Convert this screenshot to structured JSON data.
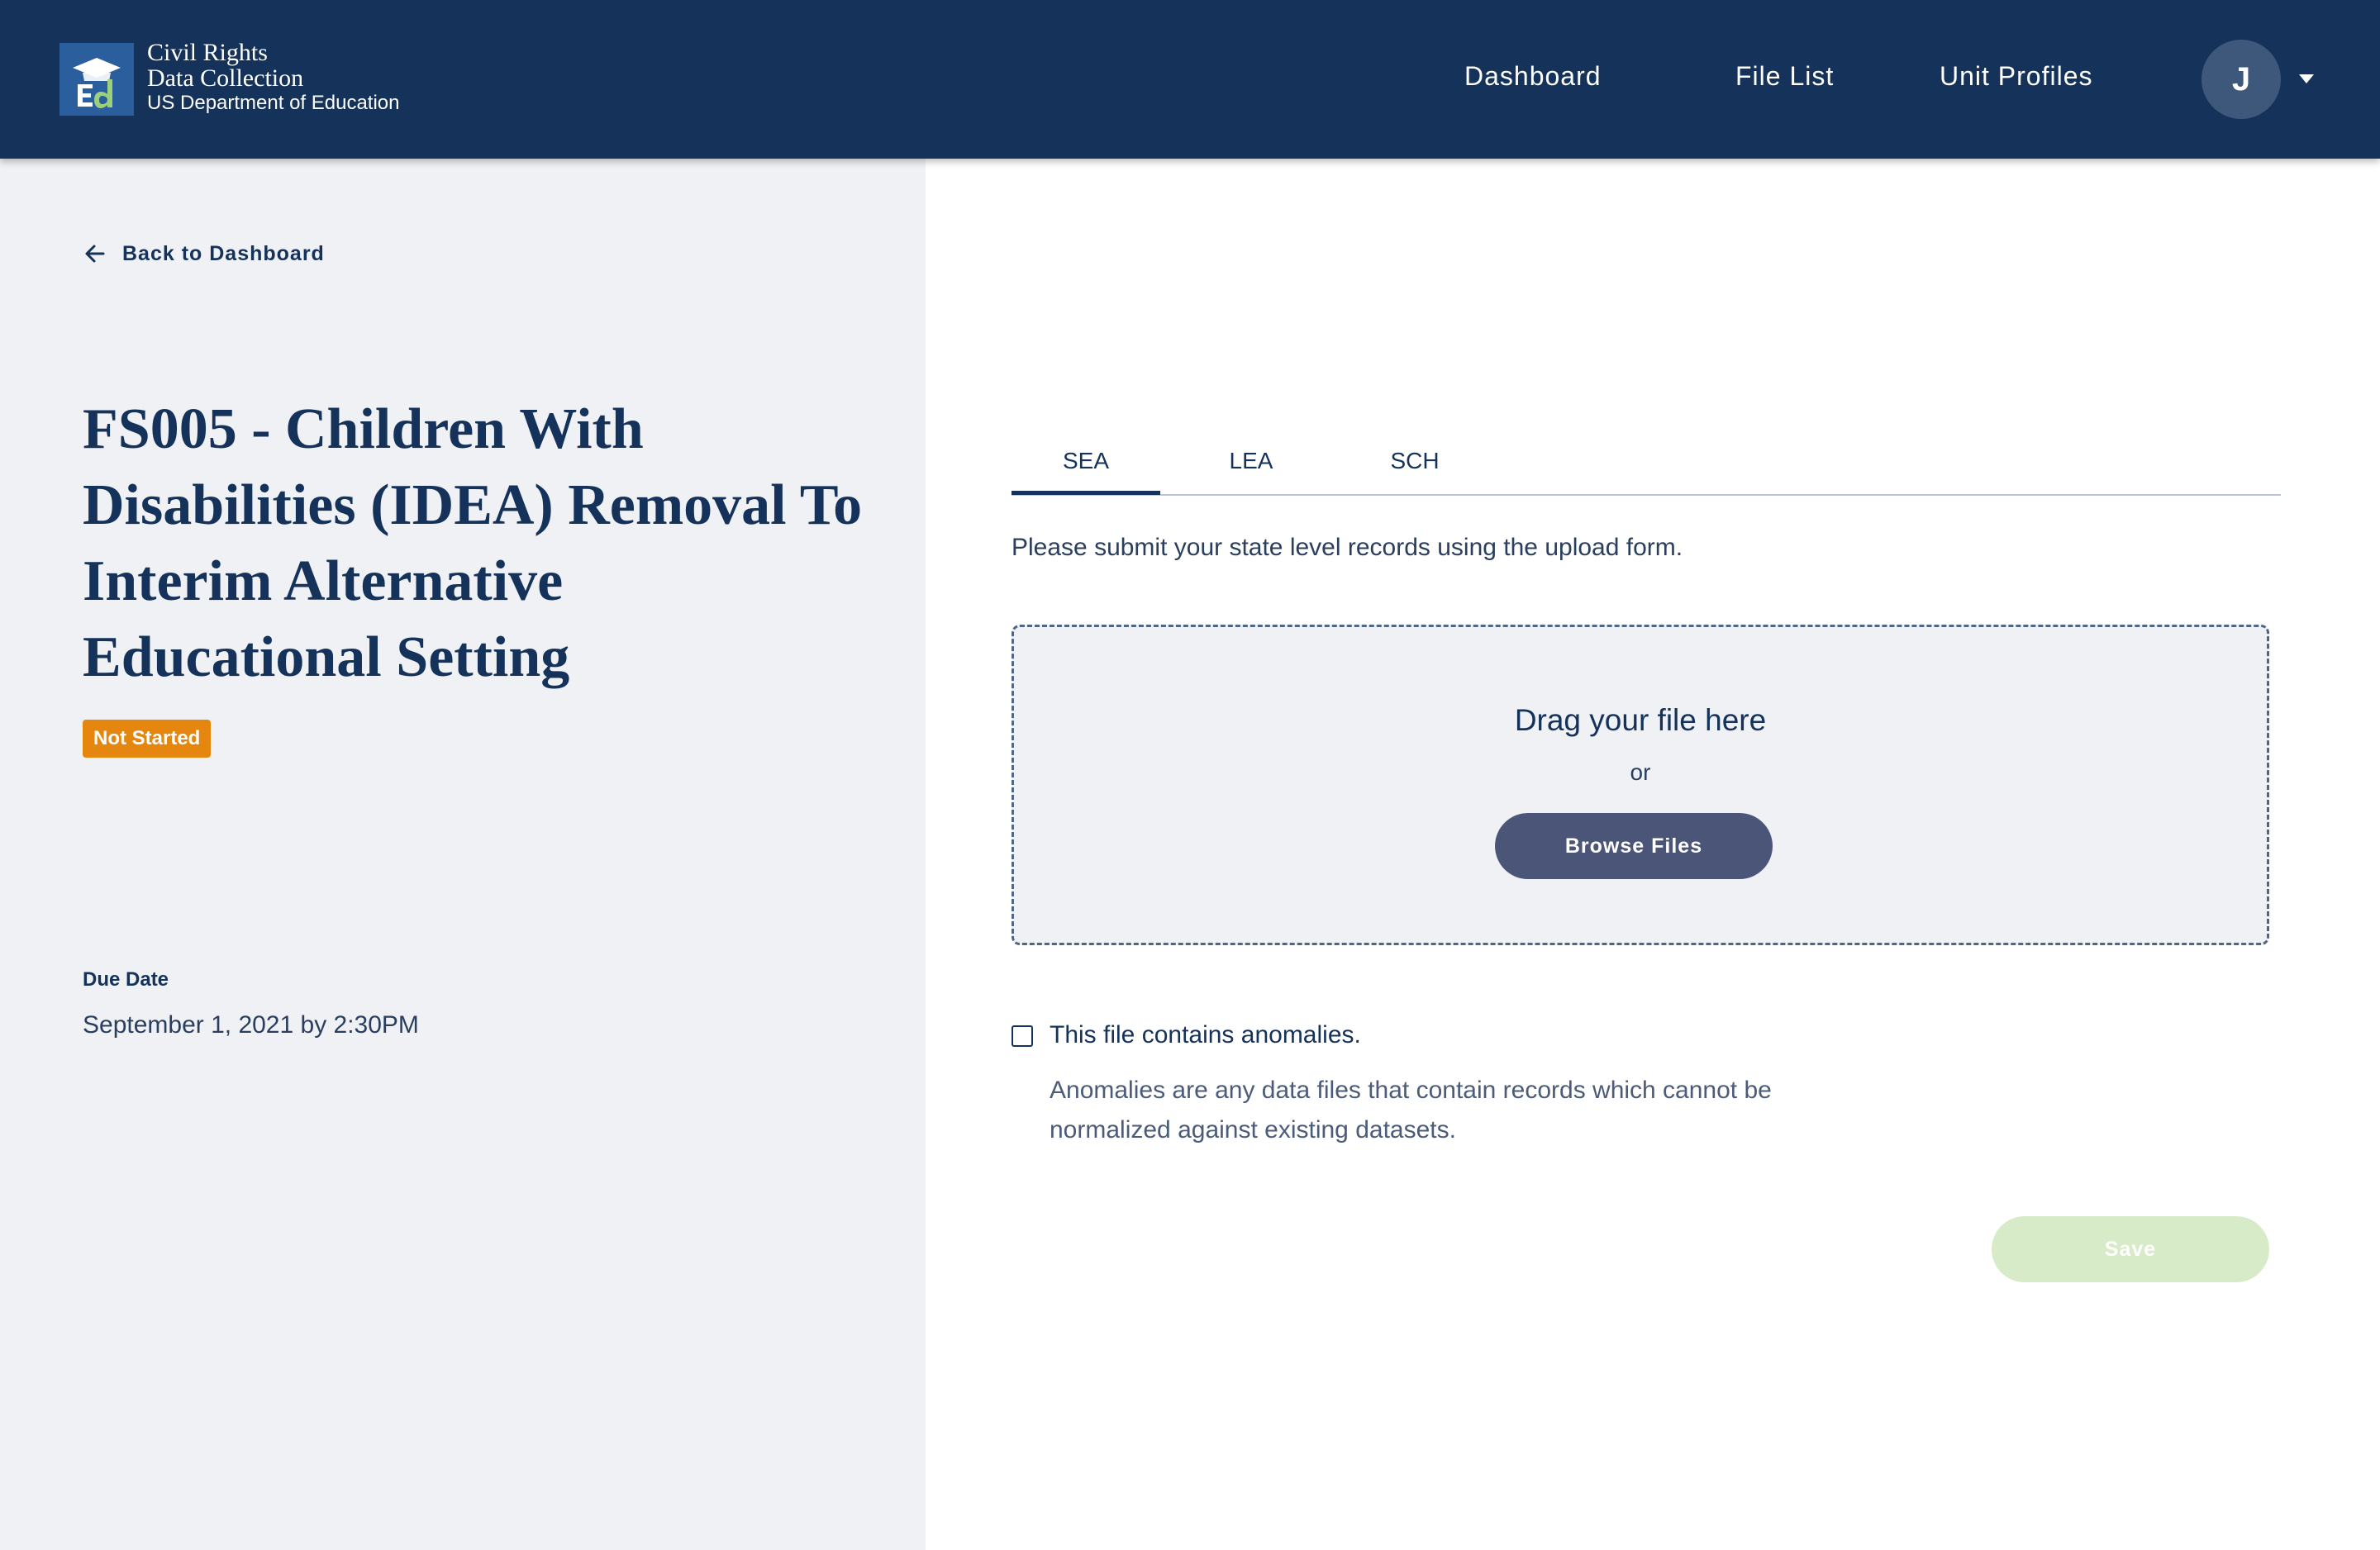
{
  "header": {
    "brand": {
      "line1": "Civil Rights",
      "line2": "Data Collection",
      "line3": "US Department of Education",
      "logo_text": "Ed",
      "logo_icon": "graduation-cap-icon"
    },
    "nav": {
      "dashboard": "Dashboard",
      "file_list": "File List",
      "unit_profiles": "Unit Profiles"
    },
    "user": {
      "initial": "J",
      "menu_icon": "caret-down-icon"
    }
  },
  "left_panel": {
    "back_link": {
      "label": "Back to Dashboard",
      "icon": "arrow-left-icon"
    },
    "title": "FS005 - Children With Disabilities (IDEA) Removal To Interim Alternative Educational Setting",
    "status": "Not Started",
    "due_date_label": "Due Date",
    "due_date_value": "September 1, 2021 by 2:30PM"
  },
  "tabs": [
    {
      "label": "SEA",
      "selected": true
    },
    {
      "label": "LEA",
      "selected": false
    },
    {
      "label": "SCH",
      "selected": false
    }
  ],
  "upload": {
    "instruction": "Please submit your state level records using the upload form.",
    "drop_title": "Drag your file here",
    "or_text": "or",
    "browse_label": "Browse Files"
  },
  "anomalies": {
    "checked": false,
    "label": "This file contains anomalies.",
    "description": "Anomalies are any data files that contain records which cannot be normalized against existing datasets."
  },
  "save_label": "Save",
  "colors": {
    "header_bg": "#14325a",
    "left_panel_bg": "#f0f1f5",
    "status_badge": "#e5860f",
    "browse_button": "#4b5578",
    "save_button_disabled": "#d8ebc8"
  }
}
